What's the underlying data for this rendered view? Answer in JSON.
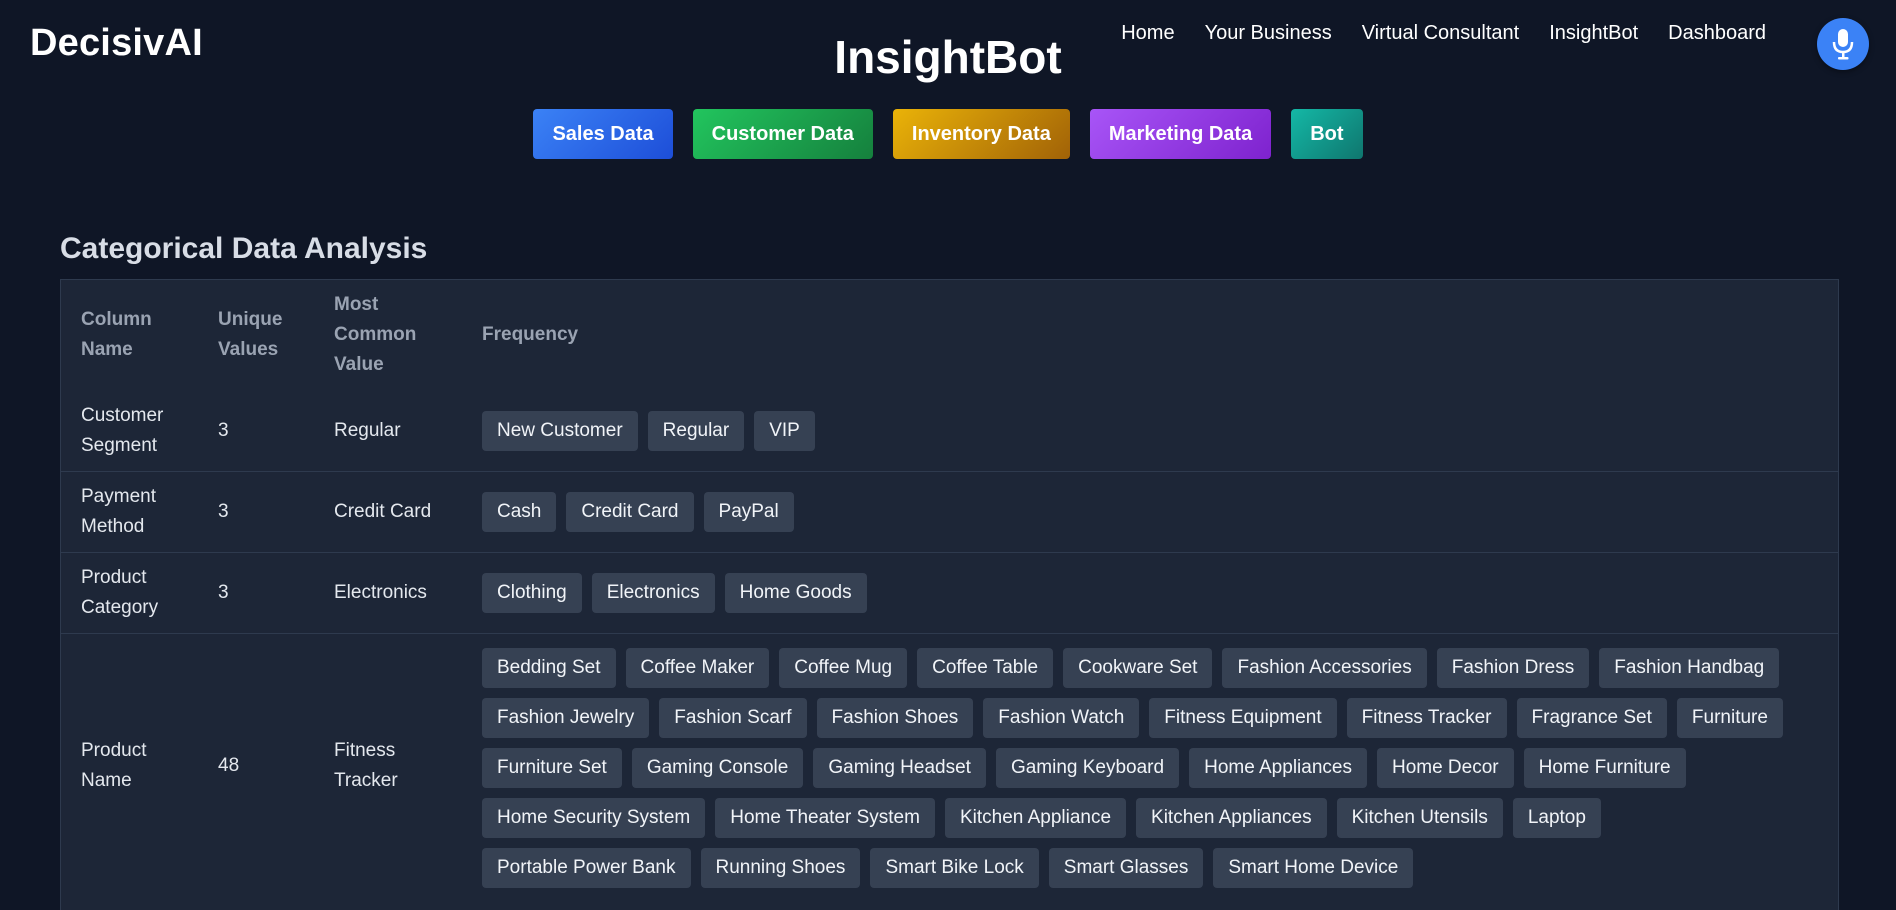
{
  "brand": "DecisivAI",
  "title": "InsightBot",
  "nav": [
    "Home",
    "Your Business",
    "Virtual Consultant",
    "InsightBot",
    "Dashboard"
  ],
  "mic_icon": "microphone-icon",
  "tabs": [
    {
      "label": "Sales Data",
      "color_from": "#3b82f6",
      "color_to": "#1d4ed8"
    },
    {
      "label": "Customer Data",
      "color_from": "#22c55e",
      "color_to": "#15803d"
    },
    {
      "label": "Inventory Data",
      "color_from": "#eab308",
      "color_to": "#a16207"
    },
    {
      "label": "Marketing Data",
      "color_from": "#a855f7",
      "color_to": "#7e22ce"
    },
    {
      "label": "Bot",
      "color_from": "#14b8a6",
      "color_to": "#0f766e"
    }
  ],
  "section_title": "Categorical Data Analysis",
  "table": {
    "headers": [
      "Column Name",
      "Unique Values",
      "Most Common Value",
      "Frequency"
    ],
    "rows": [
      {
        "name": "Customer Segment",
        "unique": "3",
        "common": "Regular",
        "values": [
          "New Customer",
          "Regular",
          "VIP"
        ]
      },
      {
        "name": "Payment Method",
        "unique": "3",
        "common": "Credit Card",
        "values": [
          "Cash",
          "Credit Card",
          "PayPal"
        ]
      },
      {
        "name": "Product Category",
        "unique": "3",
        "common": "Electronics",
        "values": [
          "Clothing",
          "Electronics",
          "Home Goods"
        ]
      },
      {
        "name": "Product Name",
        "unique": "48",
        "common": "Fitness Tracker",
        "values": [
          "Bedding Set",
          "Coffee Maker",
          "Coffee Mug",
          "Coffee Table",
          "Cookware Set",
          "Fashion Accessories",
          "Fashion Dress",
          "Fashion Handbag",
          "Fashion Jewelry",
          "Fashion Scarf",
          "Fashion Shoes",
          "Fashion Watch",
          "Fitness Equipment",
          "Fitness Tracker",
          "Fragrance Set",
          "Furniture",
          "Furniture Set",
          "Gaming Console",
          "Gaming Headset",
          "Gaming Keyboard",
          "Home Appliances",
          "Home Decor",
          "Home Furniture",
          "Home Security System",
          "Home Theater System",
          "Kitchen Appliance",
          "Kitchen Appliances",
          "Kitchen Utensils",
          "Laptop",
          "Portable Power Bank",
          "Running Shoes",
          "Smart Bike Lock",
          "Smart Glasses",
          "Smart Home Device"
        ]
      }
    ]
  }
}
